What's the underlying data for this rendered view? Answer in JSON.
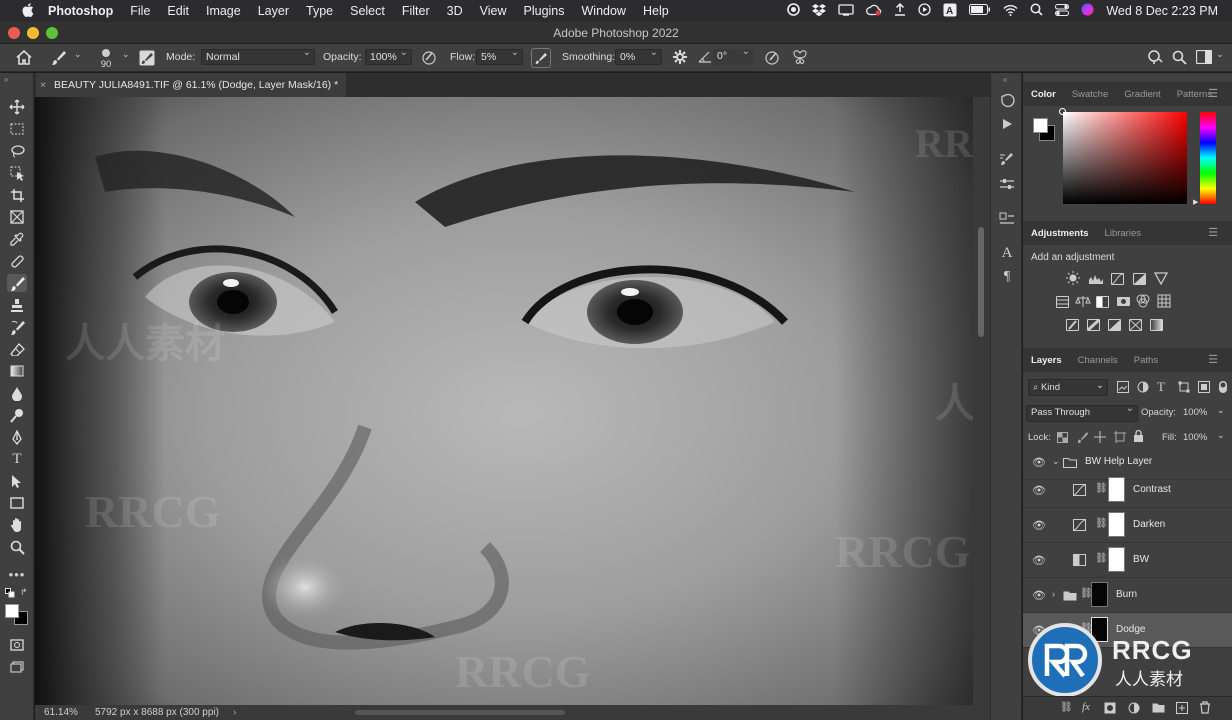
{
  "menubar": {
    "apple": "",
    "app_name": "Photoshop",
    "items": [
      "File",
      "Edit",
      "Image",
      "Layer",
      "Type",
      "Select",
      "Filter",
      "3D",
      "View",
      "Plugins",
      "Window",
      "Help"
    ],
    "datetime": "Wed 8 Dec  2:23 PM"
  },
  "window": {
    "title": "Adobe Photoshop 2022"
  },
  "options_bar": {
    "brush_size": "90",
    "mode_label": "Mode:",
    "mode_value": "Normal",
    "opacity_label": "Opacity:",
    "opacity_value": "100%",
    "flow_label": "Flow:",
    "flow_value": "5%",
    "smoothing_label": "Smoothing:",
    "smoothing_value": "0%",
    "angle_value": "0°"
  },
  "document": {
    "tab_label": "BEAUTY JULIA8491.TIF @ 61.1% (Dodge, Layer Mask/16) *",
    "zoom": "61.14%",
    "info": "5792 px x 8688 px (300 ppi)"
  },
  "color_panel": {
    "tabs": [
      "Color",
      "Swatche",
      "Gradient",
      "Patterns"
    ],
    "active_tab": 0,
    "foreground": "#ffffff",
    "background": "#000000",
    "hue": "#ff0000"
  },
  "adjustments_panel": {
    "tabs": [
      "Adjustments",
      "Libraries"
    ],
    "prompt": "Add an adjustment"
  },
  "layers_panel": {
    "tabs": [
      "Layers",
      "Channels",
      "Paths"
    ],
    "filter_kind": "Kind",
    "blend_mode": "Pass Through",
    "opacity_label": "Opacity:",
    "opacity_value": "100%",
    "lock_label": "Lock:",
    "fill_label": "Fill:",
    "fill_value": "100%",
    "layers": [
      {
        "name": "BW Help Layer",
        "kind": "group",
        "expanded": true
      },
      {
        "name": "Contrast",
        "kind": "curves-adjustment"
      },
      {
        "name": "Darken",
        "kind": "curves-adjustment"
      },
      {
        "name": "BW",
        "kind": "black-white-adjustment"
      },
      {
        "name": "Burn",
        "kind": "group",
        "expanded": false
      },
      {
        "name": "Dodge",
        "kind": "group-selected"
      }
    ]
  },
  "watermark": {
    "text": "RRCG",
    "subtext": "人人素材"
  }
}
